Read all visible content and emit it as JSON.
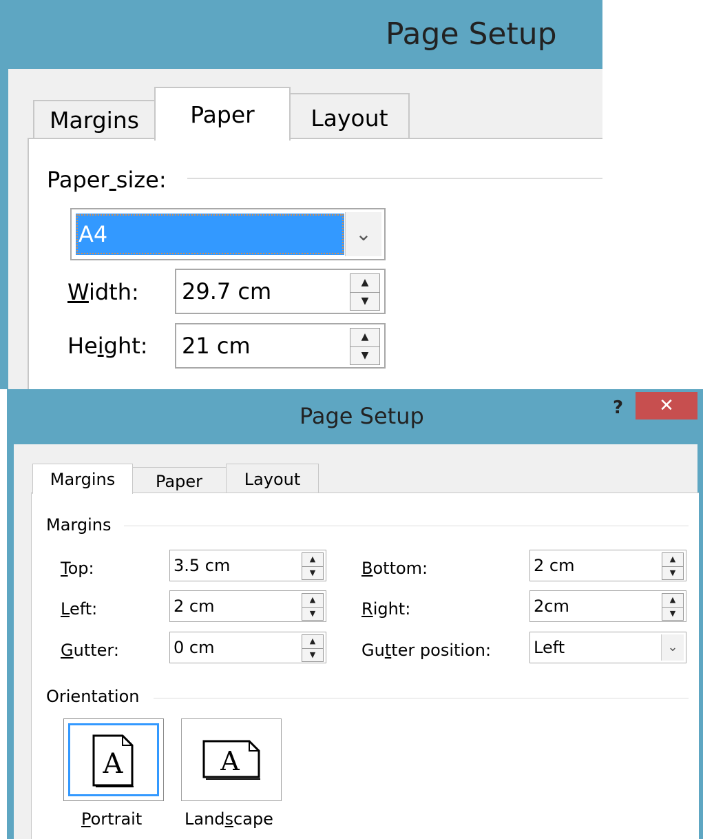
{
  "top_dialog": {
    "title": "Page Setup",
    "tabs": [
      "Margins",
      "Paper",
      "Layout"
    ],
    "active_tab": "Paper",
    "paper_size": {
      "group_label_pre": "Paper",
      "group_label_u": " ",
      "group_label_post": "size:",
      "selected": "A4"
    },
    "width": {
      "label_u": "W",
      "label_rest": "idth:",
      "value": "29.7 cm"
    },
    "height": {
      "label_pre": "He",
      "label_u": "i",
      "label_rest": "ght:",
      "value": "21 cm"
    }
  },
  "bottom_dialog": {
    "title": "Page Setup",
    "help": "?",
    "close": "✕",
    "tabs": [
      "Margins",
      "Paper",
      "Layout"
    ],
    "active_tab": "Margins",
    "margins_group": "Margins",
    "fields": {
      "top": {
        "label_u": "T",
        "label_rest": "op:",
        "value": "3.5 cm"
      },
      "left": {
        "label_u": "L",
        "label_rest": "eft:",
        "value": "2 cm"
      },
      "gutter": {
        "label_u": "G",
        "label_rest": "utter:",
        "value": "0 cm"
      },
      "bottom": {
        "label_u": "B",
        "label_rest": "ottom:",
        "value": "2 cm"
      },
      "right": {
        "label_u": "R",
        "label_rest": "ight:",
        "value": "2cm"
      },
      "gutter_position": {
        "label_pre": "Gu",
        "label_u": "t",
        "label_rest": "ter position:",
        "value": "Left"
      }
    },
    "orientation_group": "Orientation",
    "orientation": {
      "selected": "Portrait",
      "portrait": {
        "label_u": "P",
        "label_rest": "ortrait",
        "glyph": "A"
      },
      "landscape": {
        "label_pre": "Land",
        "label_u": "s",
        "label_rest": "cape",
        "glyph": "A"
      }
    }
  },
  "colors": {
    "titlebar": "#5ea6c2",
    "selection": "#3399ff",
    "close": "#c74f4f"
  }
}
